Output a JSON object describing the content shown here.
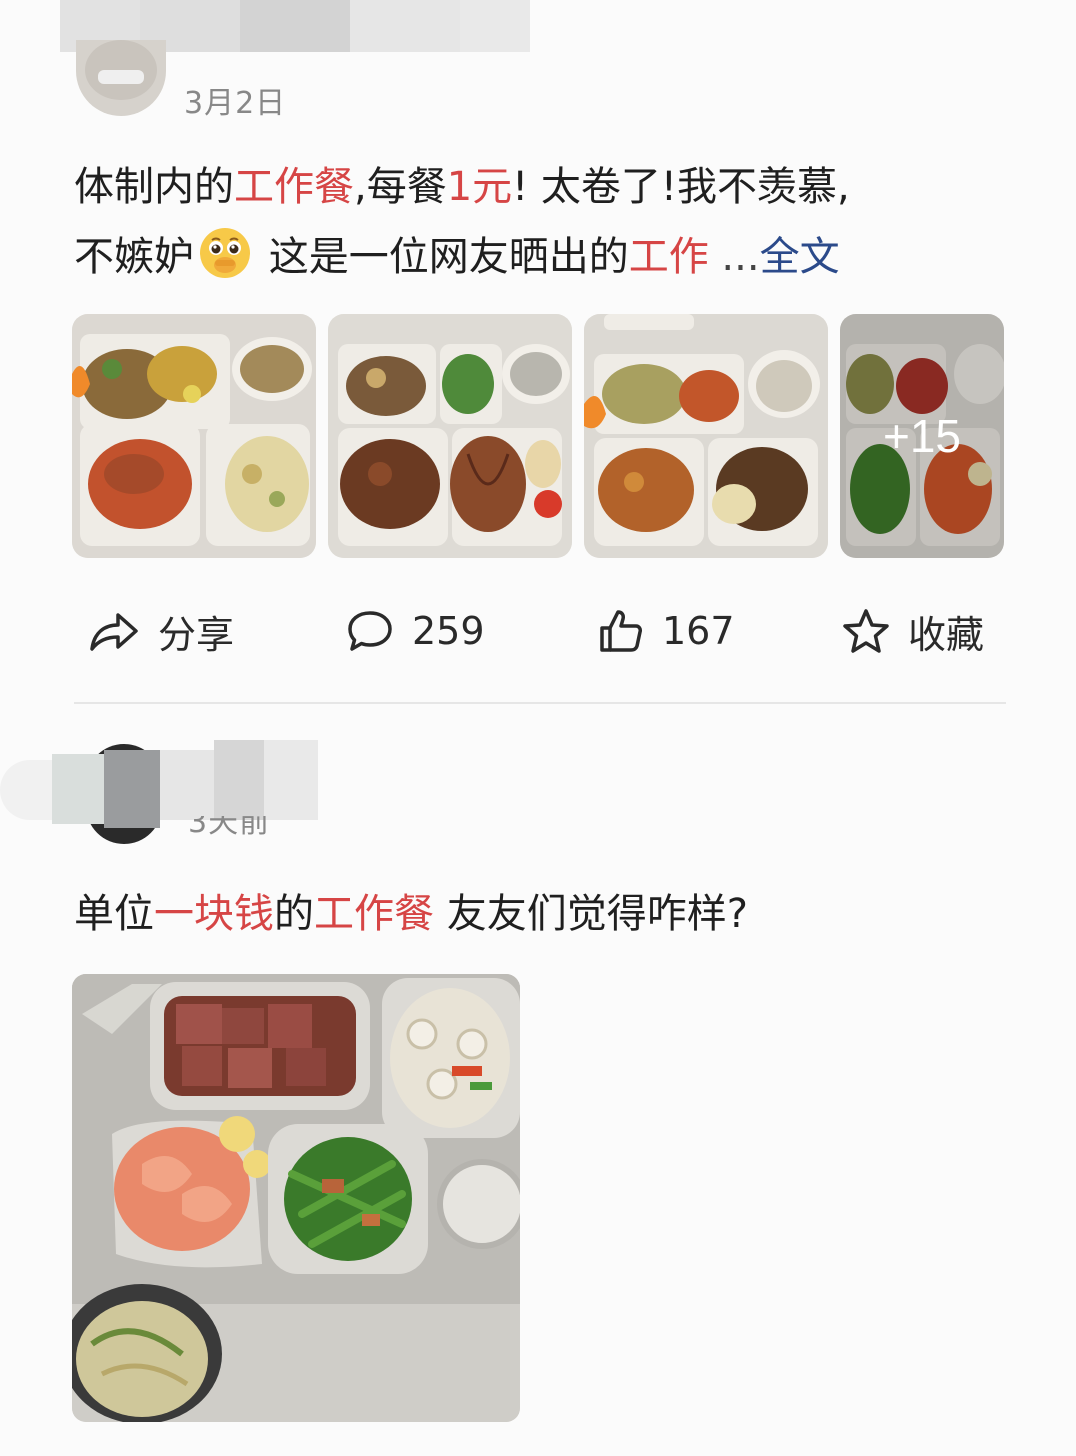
{
  "posts": [
    {
      "time": "3月2日",
      "text": {
        "p1": "体制内的",
        "h1": "工作餐",
        "p2": ",每餐",
        "h2": "1元",
        "p3": "! 太卷了!我不羡慕,",
        "p4": "不嫉妒",
        "p5": " 这是一位网友晒出的",
        "h3": "工作",
        "ellipsis": " ...",
        "more": "全文"
      },
      "emoji": "covering-mouth-teary-emoji",
      "images": [
        {
          "name": "meal-photo-1"
        },
        {
          "name": "meal-photo-2"
        },
        {
          "name": "meal-photo-3"
        },
        {
          "name": "meal-photo-4",
          "overlay": "+15"
        }
      ],
      "actions": {
        "share": {
          "label": "分享",
          "icon": "share-icon"
        },
        "comment": {
          "label": "259",
          "icon": "comment-icon"
        },
        "like": {
          "label": "167",
          "icon": "thumbs-up-icon"
        },
        "favorite": {
          "label": "收藏",
          "icon": "star-icon"
        }
      }
    },
    {
      "time": "3天前",
      "text": {
        "p1": "单位",
        "h1": "一块钱",
        "p2": "的",
        "h2": "工作餐",
        "p3": " 友友们觉得咋样?"
      },
      "image": {
        "name": "cafeteria-tray-photo"
      }
    }
  ],
  "colors": {
    "highlight": "#d64545",
    "link": "#2b4a8a",
    "text": "#1f1f1f",
    "muted": "#888888"
  }
}
